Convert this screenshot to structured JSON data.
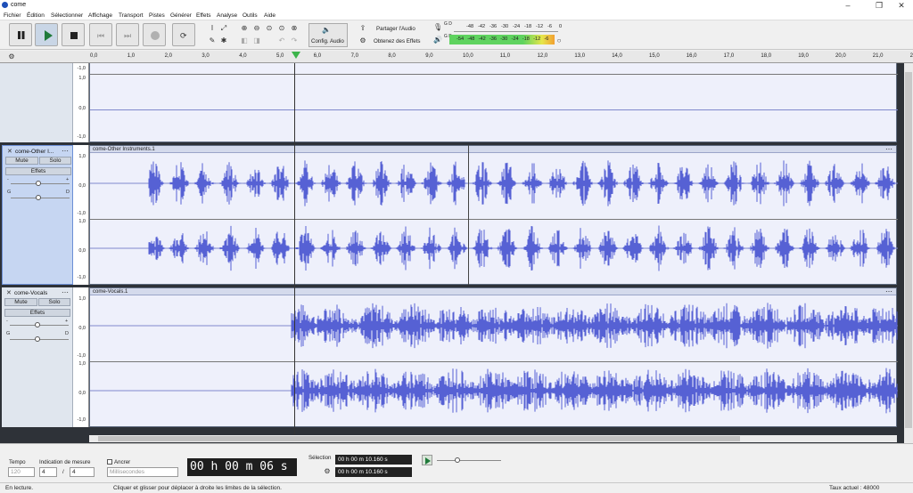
{
  "window": {
    "title": "come"
  },
  "menu": [
    "Fichier",
    "Édition",
    "Sélectionner",
    "Affichage",
    "Transport",
    "Pistes",
    "Générer",
    "Effets",
    "Analyse",
    "Outils",
    "Aide"
  ],
  "toolbar": {
    "share_audio": "Partager l'Audio",
    "get_effects": "Obtenez des Effets",
    "config_audio": "Config. Audio"
  },
  "meters": {
    "record_ticks": [
      "-48",
      "-42",
      "-36",
      "-30",
      "-24",
      "-18",
      "-12",
      "-6",
      "0"
    ],
    "play_ticks": [
      "-54",
      "-48",
      "-42",
      "-36",
      "-30",
      "-24",
      "-18",
      "-12",
      "-6"
    ],
    "record_lr": "G D",
    "play_lr": "G D"
  },
  "ruler": {
    "ticks": [
      "0,0",
      "1,0",
      "2,0",
      "3,0",
      "4,0",
      "5,0",
      "6,0",
      "7,0",
      "8,0",
      "9,0",
      "10,0",
      "11,0",
      "12,0",
      "13,0",
      "14,0",
      "15,0",
      "16,0",
      "17,0",
      "18,0",
      "19,0",
      "20,0",
      "21,0",
      "22,0"
    ],
    "playhead_seconds": 5.5
  },
  "scale_labels": {
    "top_track": [
      "-1,0",
      "1,0",
      "0,0",
      "-1,0"
    ],
    "stereo": [
      "1,0",
      "0,0",
      "-1,0"
    ]
  },
  "tracks": [
    {
      "name": "come-Other I...",
      "clip": "come-Other Instruments.1",
      "mute": "Mute",
      "solo": "Solo",
      "effects": "Effets",
      "gain_minus": "-",
      "gain_plus": "+",
      "pan_left": "G",
      "pan_right": "D"
    },
    {
      "name": "come-Vocals",
      "clip": "come-Vocals.1",
      "mute": "Mute",
      "solo": "Solo",
      "effects": "Effets",
      "gain_minus": "-",
      "gain_plus": "+",
      "pan_left": "G",
      "pan_right": "D"
    }
  ],
  "bottom": {
    "tempo_label": "Tempo",
    "tempo_value": "120",
    "timesig_label": "Indication de mesure",
    "timesig_num": "4",
    "timesig_sep": "/",
    "timesig_den": "4",
    "snap_label": "Ancrer",
    "snap_unit": "Millisecondes",
    "time_display": "00 h 00 m 06 s",
    "selection_label": "Sélection",
    "sel_start": "00 h 00 m 10.160 s",
    "sel_end": "00 h 00 m 10.160 s"
  },
  "status": {
    "state": "En lecture.",
    "hint": "Cliquer et glisser pour déplacer à droite les limites de la sélection.",
    "rate": "Taux actuel : 48000"
  },
  "colors": {
    "waveform": "#5661d4",
    "wave_bg": "#eef0fb",
    "playhead": "#333333",
    "track_bg": "#2e3238"
  }
}
